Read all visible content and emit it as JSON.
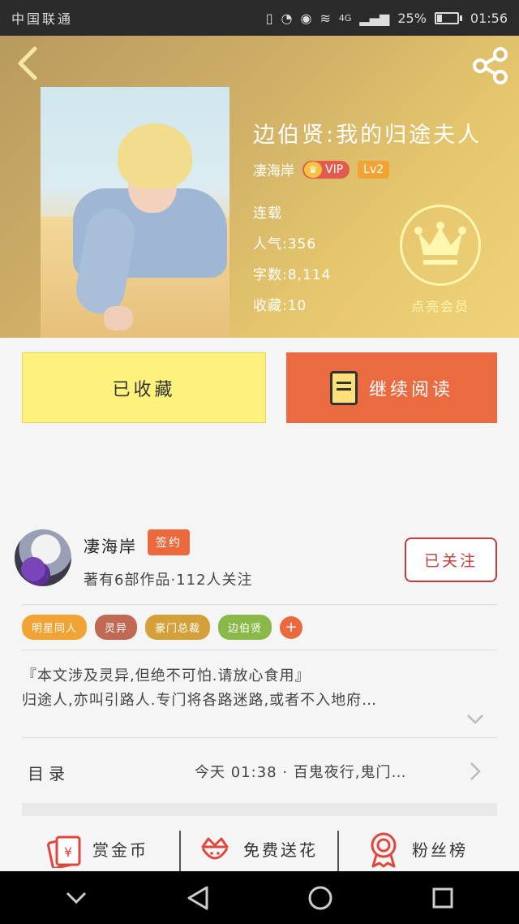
{
  "status_bar": {
    "carrier": "中国联通",
    "network": "4G",
    "battery": "25%",
    "time": "01:56"
  },
  "book": {
    "title": "边伯贤:我的归途夫人",
    "author": "凄海岸",
    "vip_label": "VIP",
    "level_label": "Lv2",
    "status": "连载",
    "popularity": "人气:356",
    "word_count": "字数:8,114",
    "favorites": "收藏:10",
    "member_label": "点亮会员"
  },
  "actions": {
    "collected_label": "已收藏",
    "continue_label": "继续阅读"
  },
  "author_card": {
    "name": "凄海岸",
    "badge": "签约",
    "stats": "著有6部作品·112人关注",
    "follow_label": "已关注"
  },
  "tags": [
    {
      "label": "明星同人",
      "color": "#f1a334"
    },
    {
      "label": "灵异",
      "color": "#c06a53"
    },
    {
      "label": "豪门总裁",
      "color": "#d4a03a"
    },
    {
      "label": "边伯贤",
      "color": "#8ab94a"
    }
  ],
  "tag_add": "+",
  "synopsis": {
    "line1": "『本文涉及灵异,但绝不可怕.请放心食用』",
    "line2": "归途人,亦叫引路人.专门将各路迷路,或者不入地府…"
  },
  "toc": {
    "label": "目录",
    "latest": "今天 01:38 · 百鬼夜行,鬼门…"
  },
  "bottom": {
    "reward": "赏金币",
    "flower": "免费送花",
    "fans": "粉丝榜"
  },
  "colors": {
    "accent": "#ec6a3f",
    "collected_bg": "#fff27c",
    "follow": "#c53b3b"
  }
}
